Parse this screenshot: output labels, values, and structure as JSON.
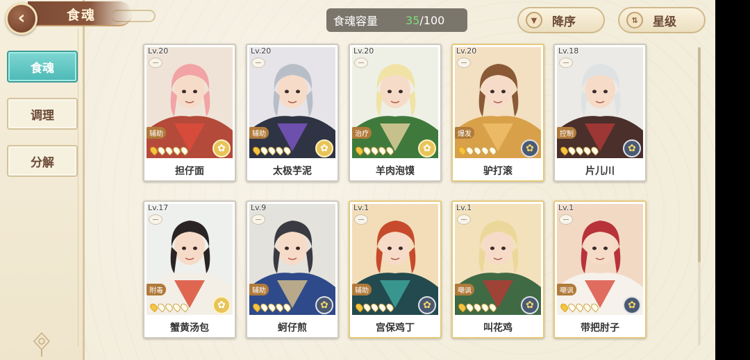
{
  "header": {
    "title": "食魂",
    "back_icon": "back-arrow-icon",
    "capacity_label": "食魂容量",
    "capacity_current": "35",
    "capacity_max": "/100",
    "sort_button_label": "降序",
    "sort_icon": "triangle-down-icon",
    "filter_button_label": "星级",
    "filter_icon": "swap-arrows-icon"
  },
  "sidebar": {
    "tabs": [
      {
        "label": "食魂",
        "active": true
      },
      {
        "label": "调理",
        "active": false
      },
      {
        "label": "分解",
        "active": false
      }
    ]
  },
  "cards": [
    {
      "level": "Lv.20",
      "role": "辅助",
      "name": "担仔面",
      "stars": 1,
      "emblem": "gold",
      "frame": "silver",
      "palette": {
        "hair": "#f2a3a6",
        "cloth": "#b44a3a",
        "bg": "#efe3d7",
        "accent": "#e04b3c"
      }
    },
    {
      "level": "Lv.20",
      "role": "辅助",
      "name": "太极芋泥",
      "stars": 1,
      "emblem": "gold",
      "frame": "silver",
      "palette": {
        "hair": "#b8bec8",
        "cloth": "#2f3444",
        "bg": "#e6e4e8",
        "accent": "#7d56c9"
      }
    },
    {
      "level": "Lv.20",
      "role": "治疗",
      "name": "羊肉泡馍",
      "stars": 1,
      "emblem": "gold",
      "frame": "silver",
      "palette": {
        "hair": "#f1e3a6",
        "cloth": "#3f7a3c",
        "bg": "#eef0e6",
        "accent": "#e9d3a0"
      }
    },
    {
      "level": "Lv.20",
      "role": "爆发",
      "name": "驴打滚",
      "stars": 1,
      "emblem": "navy",
      "frame": "gold",
      "palette": {
        "hair": "#8a5a36",
        "cloth": "#d9a04a",
        "bg": "#f3dfc2",
        "accent": "#f0c06a"
      }
    },
    {
      "level": "Lv.18",
      "role": "控制",
      "name": "片儿川",
      "stars": 1,
      "emblem": "navy",
      "frame": "silver",
      "palette": {
        "hair": "#dfe2e3",
        "cloth": "#4a2f2b",
        "bg": "#eceae6",
        "accent": "#b03a38"
      }
    },
    {
      "level": "Lv.17",
      "role": "附毒",
      "name": "蟹黄汤包",
      "stars": 1,
      "emblem": "gold",
      "frame": "silver",
      "palette": {
        "hair": "#2a2524",
        "cloth": "#f3efe6",
        "bg": "#eef0ee",
        "accent": "#d9452c"
      }
    },
    {
      "level": "Lv.9",
      "role": "辅助",
      "name": "蚵仔煎",
      "stars": 1,
      "emblem": "navy",
      "frame": "silver",
      "palette": {
        "hair": "#3a3a42",
        "cloth": "#2f4a8a",
        "bg": "#e4e2dc",
        "accent": "#d9c08a"
      }
    },
    {
      "level": "Lv.1",
      "role": "辅助",
      "name": "宫保鸡丁",
      "stars": 1,
      "emblem": "navy",
      "frame": "gold",
      "palette": {
        "hair": "#c74a2c",
        "cloth": "#234a4e",
        "bg": "#f2ddb8",
        "accent": "#3fa9a0"
      }
    },
    {
      "level": "Lv.1",
      "role": "嘲讽",
      "name": "叫花鸡",
      "stars": 1,
      "emblem": "navy",
      "frame": "gold",
      "palette": {
        "hair": "#ecd79a",
        "cloth": "#3f6a44",
        "bg": "#f3e1bc",
        "accent": "#b83a34"
      }
    },
    {
      "level": "Lv.1",
      "role": "嘲讽",
      "name": "带把肘子",
      "stars": 1,
      "emblem": "navy",
      "frame": "gold",
      "palette": {
        "hair": "#b8323a",
        "cloth": "#f6f1ea",
        "bg": "#f2d9c4",
        "accent": "#d94b3c"
      }
    }
  ]
}
